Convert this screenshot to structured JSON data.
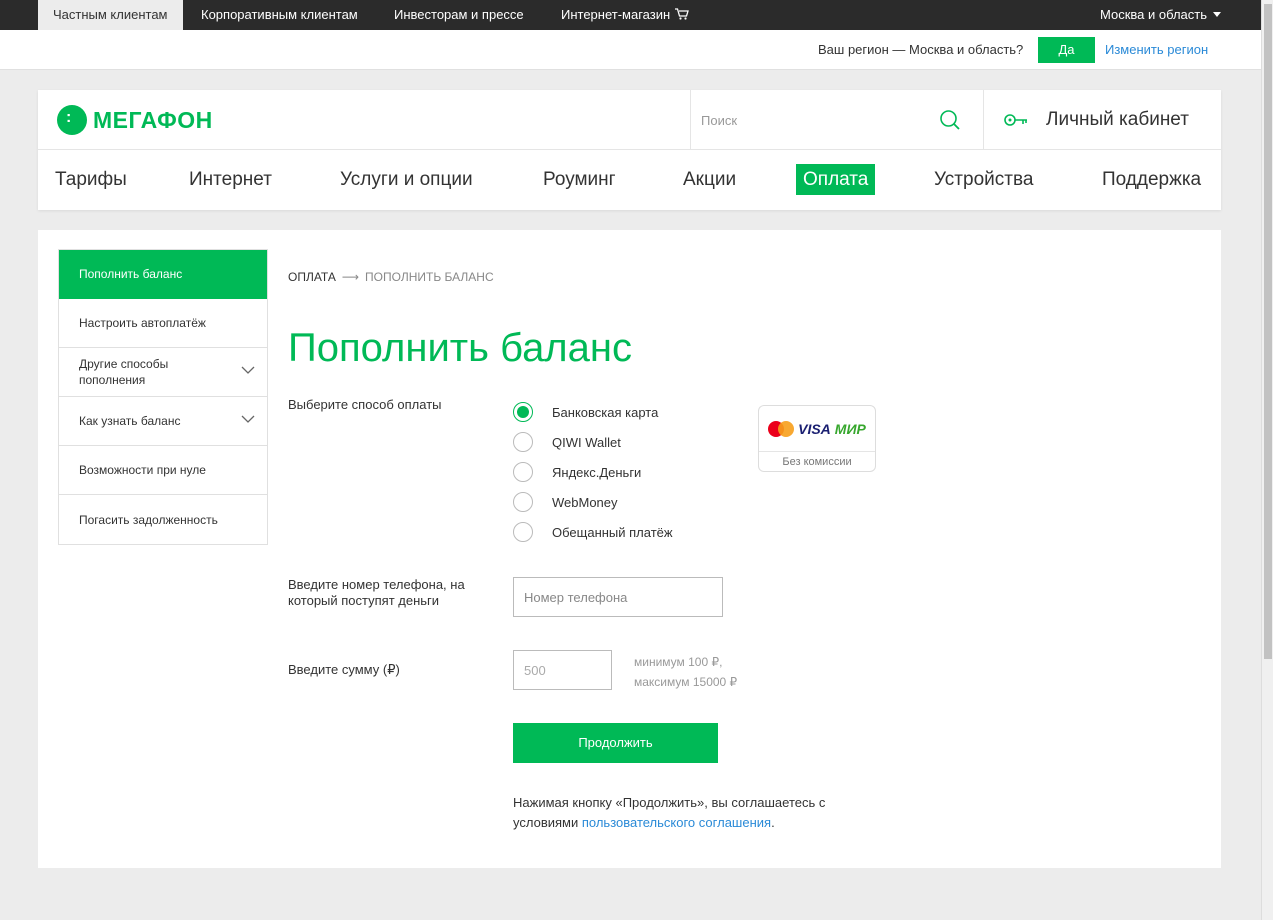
{
  "topbar": {
    "tabs": [
      {
        "label": "Частным клиентам"
      },
      {
        "label": "Корпоративным клиентам"
      },
      {
        "label": "Инвесторам и прессе"
      },
      {
        "label": "Интернет-магазин"
      }
    ],
    "region": "Москва и область"
  },
  "region_confirm": {
    "question": "Ваш регион — Москва и область?",
    "yes_label": "Да",
    "change_label": "Изменить регион"
  },
  "header": {
    "logo_text": "МегаФон",
    "search_placeholder": "Поиск",
    "cabinet_label": "Личный кабинет",
    "nav": [
      {
        "label": "Тарифы"
      },
      {
        "label": "Интернет"
      },
      {
        "label": "Услуги и опции"
      },
      {
        "label": "Роуминг"
      },
      {
        "label": "Акции"
      },
      {
        "label": "Оплата"
      },
      {
        "label": "Устройства"
      },
      {
        "label": "Поддержка"
      }
    ]
  },
  "sidebar": {
    "items": [
      {
        "label": "Пополнить баланс"
      },
      {
        "label": "Настроить автоплатёж"
      },
      {
        "label": "Другие способы пополнения"
      },
      {
        "label": "Как узнать баланс"
      },
      {
        "label": "Возможности при нуле"
      },
      {
        "label": "Погасить задолженность"
      }
    ]
  },
  "breadcrumb": {
    "parent": "Оплата",
    "current": "Пополнить баланс"
  },
  "page": {
    "title": "Пополнить баланс",
    "method_label": "Выберите способ оплаты",
    "methods": [
      {
        "label": "Банковская карта",
        "selected": true
      },
      {
        "label": "QIWI Wallet",
        "selected": false
      },
      {
        "label": "Яндекс.Деньги",
        "selected": false
      },
      {
        "label": "WebMoney",
        "selected": false
      },
      {
        "label": "Обещанный платёж",
        "selected": false
      }
    ],
    "cards_badge": {
      "visa": "VISA",
      "mir": "МИР",
      "note": "Без комиссии"
    },
    "phone_label": "Введите номер телефона, на который поступят деньги",
    "phone_placeholder": "Номер телефона",
    "sum_label": "Введите сумму (₽)",
    "sum_placeholder": "500",
    "limit_min": "минимум 100 ₽,",
    "limit_max": "максимум 15000 ₽",
    "submit_label": "Продолжить",
    "agree_text": "Нажимая кнопку «Продолжить», вы соглашаетесь с условиями",
    "agree_link": "пользовательского соглашения",
    "agree_end": "."
  },
  "colors": {
    "brand_green": "#00b956",
    "link_blue": "#2a8ad7",
    "topbar": "#2b2b2b"
  }
}
